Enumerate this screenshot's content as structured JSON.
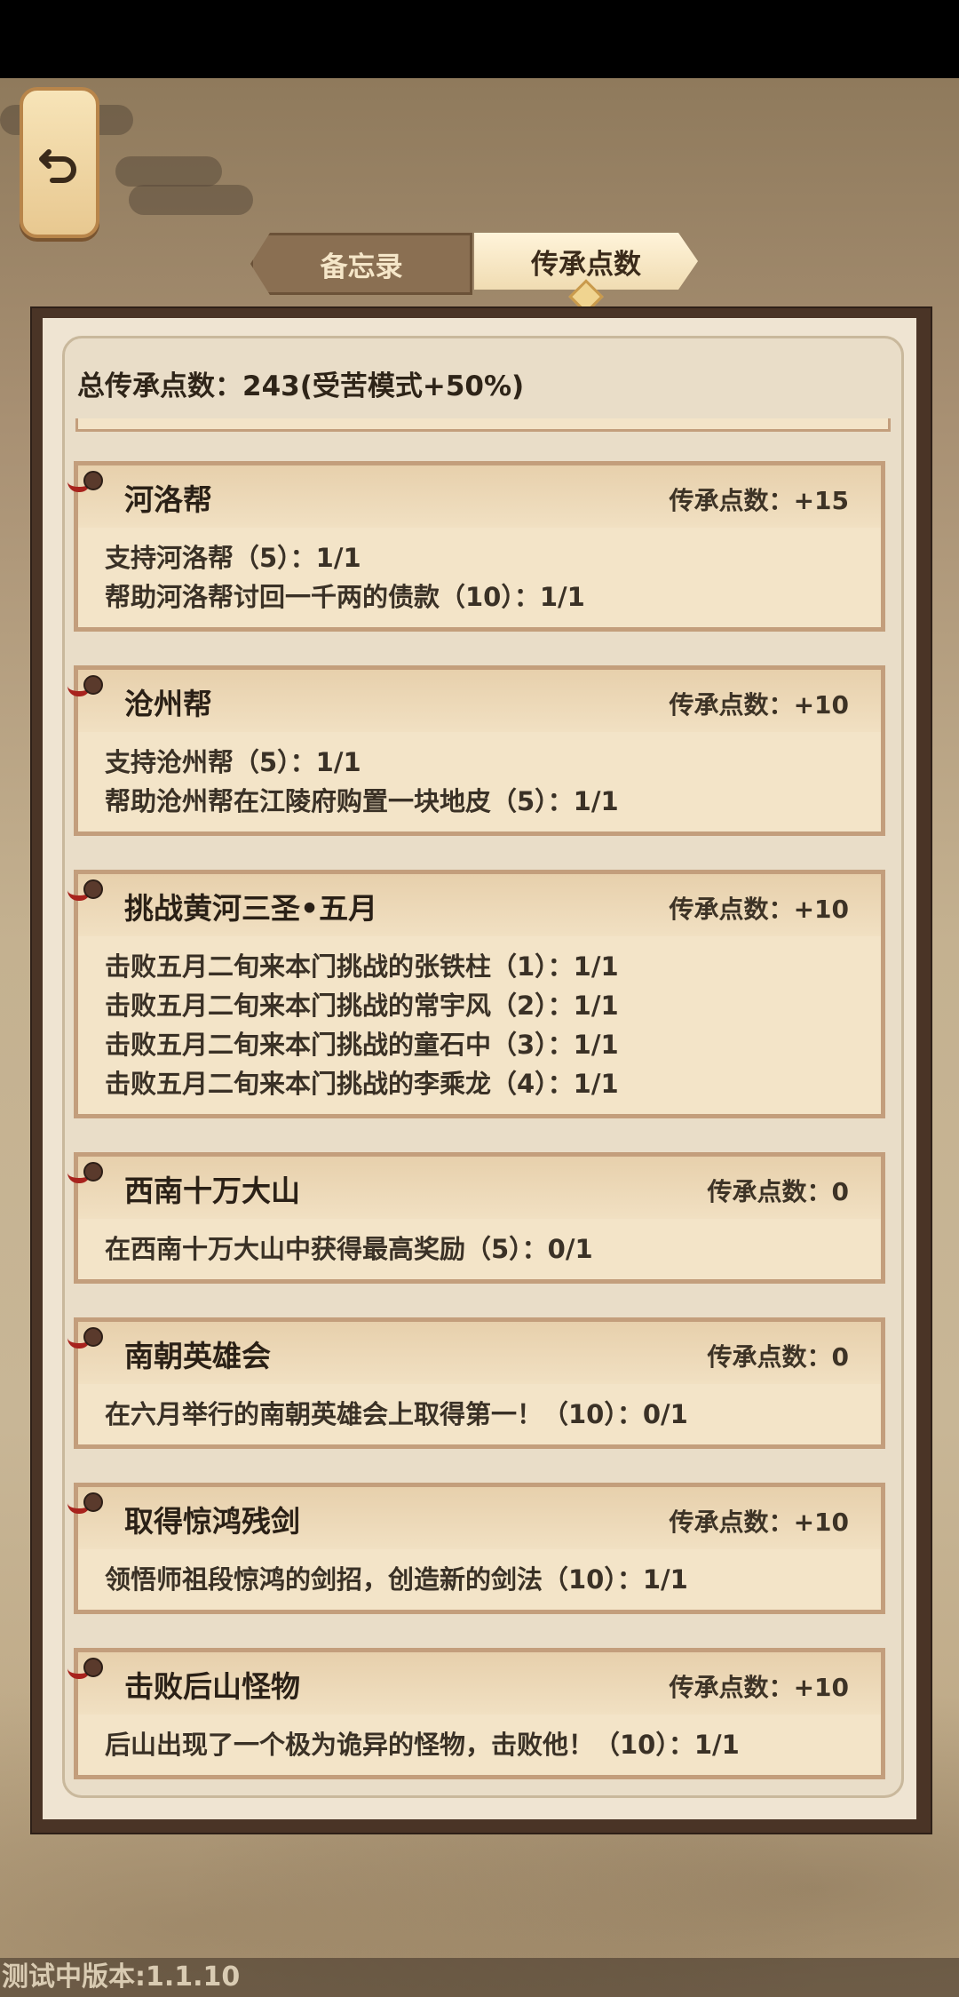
{
  "tabs": [
    {
      "label": "备忘录",
      "active": false
    },
    {
      "label": "传承点数",
      "active": true
    }
  ],
  "summary": "总传承点数：243(受苦模式+50%)",
  "points_label": "传承点数：",
  "cards": [
    {
      "title": "河洛帮",
      "points": "+15",
      "lines": [
        "支持河洛帮（5）：1/1",
        "帮助河洛帮讨回一千两的债款（10）：1/1"
      ]
    },
    {
      "title": "沧州帮",
      "points": "+10",
      "lines": [
        "支持沧州帮（5）：1/1",
        "帮助沧州帮在江陵府购置一块地皮（5）：1/1"
      ]
    },
    {
      "title": "挑战黄河三圣•五月",
      "points": "+10",
      "lines": [
        "击败五月二旬来本门挑战的张铁柱（1）：1/1",
        "击败五月二旬来本门挑战的常宇风（2）：1/1",
        "击败五月二旬来本门挑战的童石中（3）：1/1",
        "击败五月二旬来本门挑战的李乘龙（4）：1/1"
      ]
    },
    {
      "title": "西南十万大山",
      "points": "0",
      "lines": [
        "在西南十万大山中获得最高奖励（5）：0/1"
      ]
    },
    {
      "title": "南朝英雄会",
      "points": "0",
      "lines": [
        "在六月举行的南朝英雄会上取得第一！（10）：0/1"
      ]
    },
    {
      "title": "取得惊鸿残剑",
      "points": "+10",
      "lines": [
        "领悟师祖段惊鸿的剑招，创造新的剑法（10）：1/1"
      ]
    },
    {
      "title": "击败后山怪物",
      "points": "+10",
      "lines": [
        "后山出现了一个极为诡异的怪物，击败他！（10）：1/1"
      ]
    }
  ],
  "version": "测试中版本:1.1.10",
  "icons": {
    "back": "back-arrow-icon",
    "pin": "scroll-pin-icon"
  }
}
